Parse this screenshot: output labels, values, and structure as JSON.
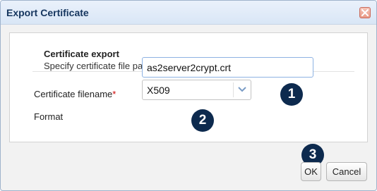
{
  "dialog": {
    "title": "Export Certificate",
    "close_icon": "close-icon"
  },
  "section": {
    "title": "Certificate export",
    "subtitle": "Specify certificate file parameters."
  },
  "fields": {
    "filename_label": "Certificate filename",
    "required_marker": "*",
    "filename_value": "as2server2crypt.crt",
    "format_label": "Format",
    "format_value": "X509"
  },
  "badges": [
    "1",
    "2",
    "3"
  ],
  "buttons": {
    "ok": "OK",
    "cancel": "Cancel"
  },
  "colors": {
    "title_text": "#15355e",
    "badge_bg": "#0d2a4e",
    "required": "#cc0000",
    "input_border": "#8db2e3"
  }
}
